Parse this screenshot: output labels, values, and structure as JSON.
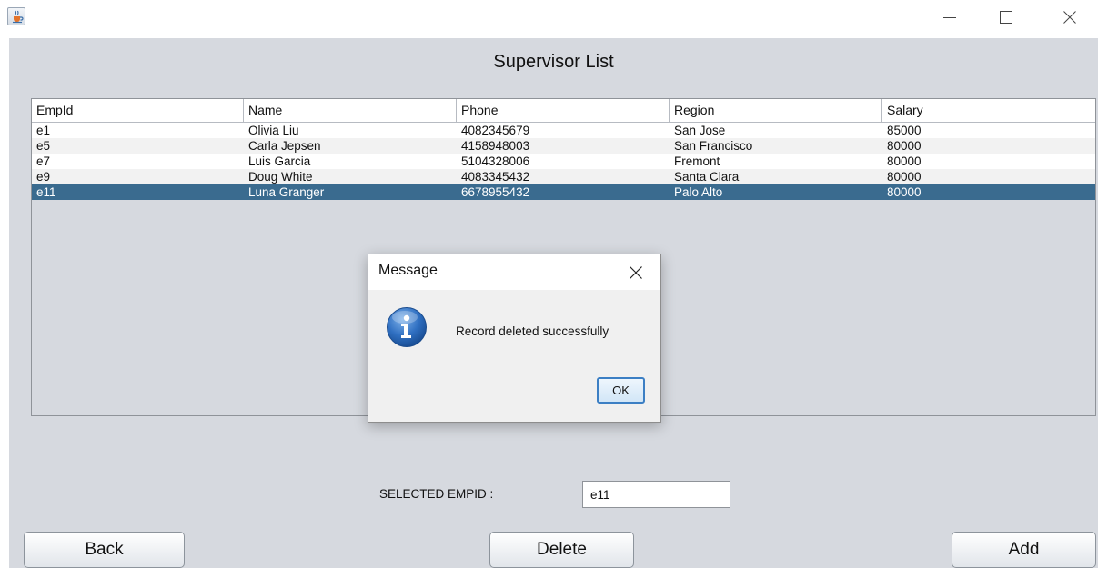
{
  "window": {
    "app_icon": "java-cup-icon",
    "controls": [
      "minimize-icon",
      "maximize-icon",
      "close-icon"
    ]
  },
  "page": {
    "title": "Supervisor List"
  },
  "table": {
    "columns": [
      "EmpId",
      "Name",
      "Phone",
      "Region",
      "Salary"
    ],
    "rows": [
      [
        "e1",
        "Olivia Liu",
        "4082345679",
        "San Jose",
        "85000"
      ],
      [
        "e5",
        "Carla Jepsen",
        "4158948003",
        "San Francisco",
        "80000"
      ],
      [
        "e7",
        "Luis Garcia",
        "5104328006",
        "Fremont",
        "80000"
      ],
      [
        "e9",
        "Doug White",
        "4083345432",
        "Santa Clara",
        "80000"
      ],
      [
        "e11",
        "Luna Granger",
        "6678955432",
        "Palo Alto",
        "80000"
      ]
    ],
    "selected_row": "e11",
    "selection_color": "#3a6b8f"
  },
  "selected": {
    "label": "SELECTED EMPID :",
    "value": "e11"
  },
  "buttons": {
    "back": "Back",
    "delete": "Delete",
    "add": "Add"
  },
  "dialog": {
    "title": "Message",
    "message": "Record deleted successfully",
    "ok": "OK",
    "icon": "info-icon",
    "icon_color": "#2f6fc1"
  }
}
